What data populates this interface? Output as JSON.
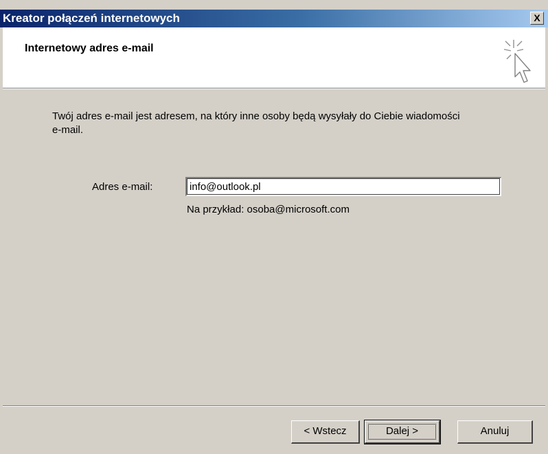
{
  "window": {
    "title": "Kreator połączeń internetowych",
    "close_label": "X"
  },
  "header": {
    "title": "Internetowy adres e-mail",
    "icon": "wizard-cursor-icon"
  },
  "content": {
    "intro": "Twój adres e-mail jest adresem, na który inne osoby będą wysyłały do Ciebie wiadomości e-mail.",
    "email_label": "Adres e-mail:",
    "email_value": "info@outlook.pl",
    "example": "Na przykład: osoba@microsoft.com"
  },
  "buttons": {
    "back": "< Wstecz",
    "next": "Dalej >",
    "cancel": "Anuluj"
  },
  "colors": {
    "titlebar_start": "#0a246a",
    "titlebar_end": "#a6caf0",
    "dialog_bg": "#d4d0c8"
  }
}
